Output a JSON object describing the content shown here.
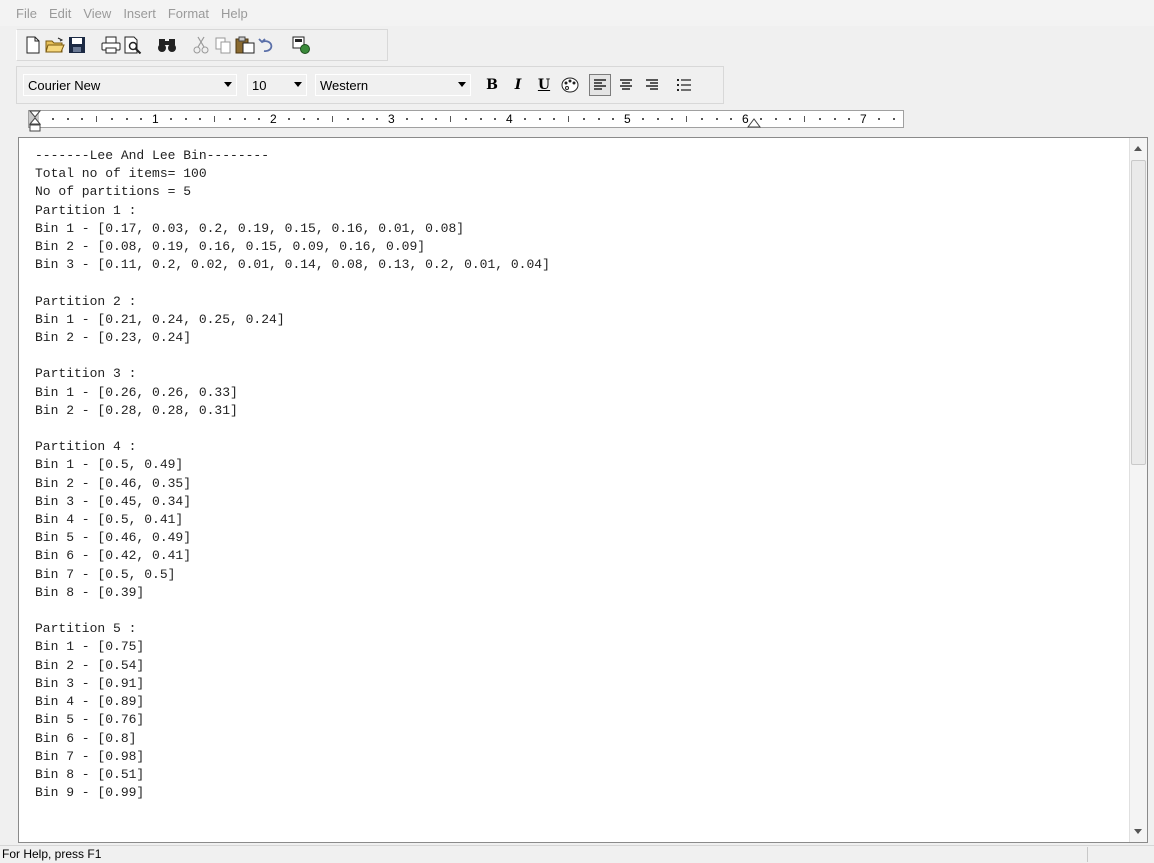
{
  "menu": [
    "File",
    "Edit",
    "View",
    "Insert",
    "Format",
    "Help"
  ],
  "toolbar": {
    "buttons": [
      "new-file-icon",
      "open-folder-icon",
      "save-icon",
      "print-icon",
      "print-preview-icon",
      "find-icon",
      "cut-icon",
      "copy-icon",
      "paste-icon",
      "undo-icon",
      "insert-object-icon"
    ]
  },
  "format": {
    "font": "Courier New",
    "size": "10",
    "script": "Western",
    "bold_label": "B",
    "italic_label": "I",
    "underline_label": "U"
  },
  "ruler": {
    "numbers": [
      "1",
      "2",
      "3",
      "4",
      "5",
      "6",
      "7"
    ]
  },
  "document": {
    "lines": [
      "-------Lee And Lee Bin--------",
      "Total no of items= 100",
      "No of partitions = 5",
      "Partition 1 :",
      "Bin 1 - [0.17, 0.03, 0.2, 0.19, 0.15, 0.16, 0.01, 0.08]",
      "Bin 2 - [0.08, 0.19, 0.16, 0.15, 0.09, 0.16, 0.09]",
      "Bin 3 - [0.11, 0.2, 0.02, 0.01, 0.14, 0.08, 0.13, 0.2, 0.01, 0.04]",
      "",
      "Partition 2 :",
      "Bin 1 - [0.21, 0.24, 0.25, 0.24]",
      "Bin 2 - [0.23, 0.24]",
      "",
      "Partition 3 :",
      "Bin 1 - [0.26, 0.26, 0.33]",
      "Bin 2 - [0.28, 0.28, 0.31]",
      "",
      "Partition 4 :",
      "Bin 1 - [0.5, 0.49]",
      "Bin 2 - [0.46, 0.35]",
      "Bin 3 - [0.45, 0.34]",
      "Bin 4 - [0.5, 0.41]",
      "Bin 5 - [0.46, 0.49]",
      "Bin 6 - [0.42, 0.41]",
      "Bin 7 - [0.5, 0.5]",
      "Bin 8 - [0.39]",
      "",
      "Partition 5 :",
      "Bin 1 - [0.75]",
      "Bin 2 - [0.54]",
      "Bin 3 - [0.91]",
      "Bin 4 - [0.89]",
      "Bin 5 - [0.76]",
      "Bin 6 - [0.8]",
      "Bin 7 - [0.98]",
      "Bin 8 - [0.51]",
      "Bin 9 - [0.99]"
    ]
  },
  "status": {
    "help_text": "For Help, press F1"
  }
}
